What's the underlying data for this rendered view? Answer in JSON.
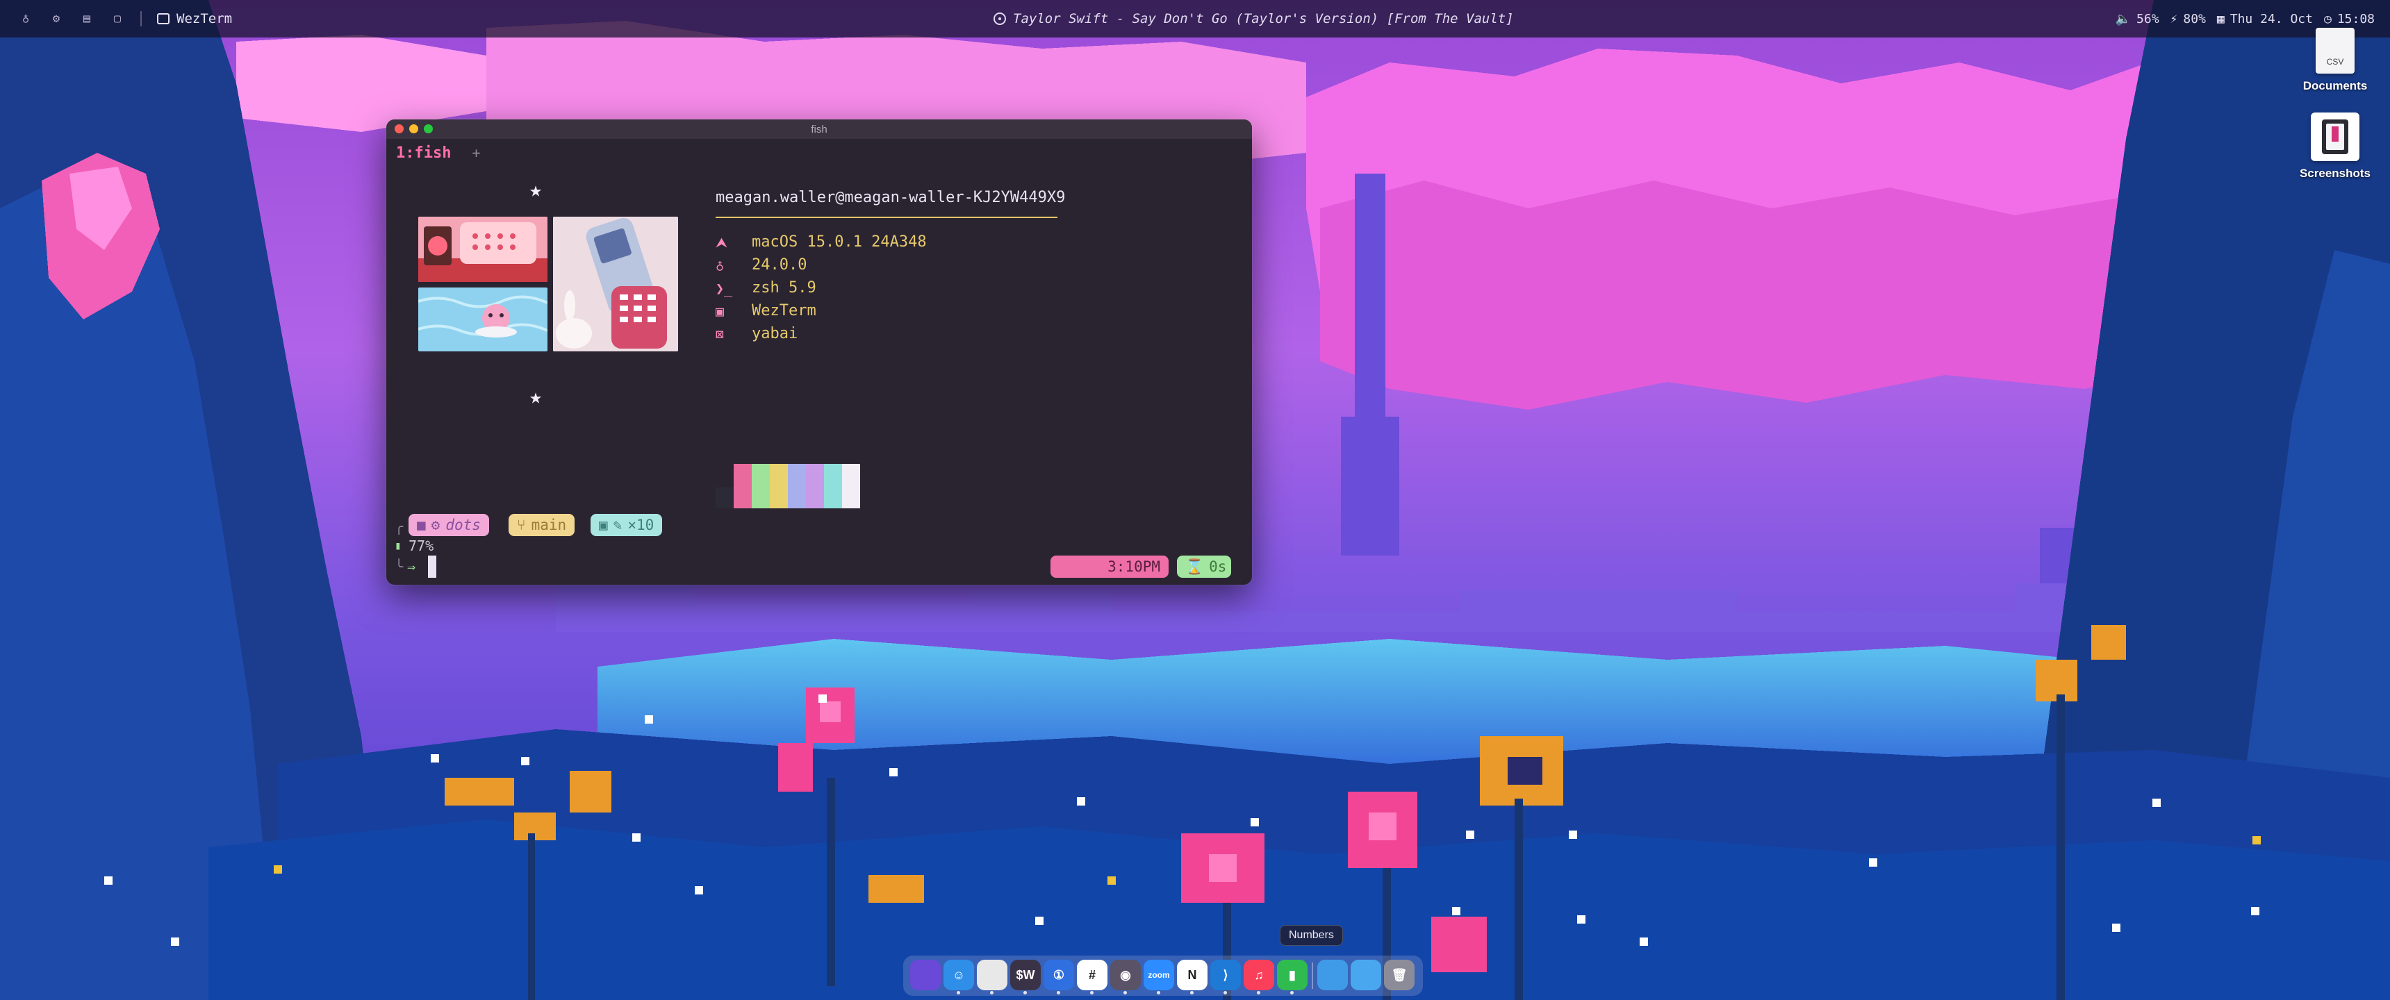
{
  "menubar": {
    "left_icons": [
      "cake-icon",
      "settings-icon",
      "stack-icon",
      "window-icon"
    ],
    "app_name": "WezTerm",
    "now_playing": "Taylor Swift - Say Don't Go (Taylor's Version) [From The Vault]",
    "volume": "56%",
    "battery": "80%",
    "date": "Thu 24. Oct",
    "time": "15:08"
  },
  "desktop": {
    "documents_label": "Documents",
    "documents_thumb_text": "CSV",
    "screenshots_label": "Screenshots"
  },
  "terminal": {
    "window_title": "fish",
    "tab_label": "1:fish",
    "tab_plus": "+",
    "fastfetch": {
      "user_host": "meagan.waller@meagan-waller-KJ2YW449X9",
      "rows": [
        {
          "icon": "⮝",
          "icon_name": "macos-icon",
          "value": "macOS 15.0.1 24A348"
        },
        {
          "icon": "♁",
          "icon_name": "kernel-icon",
          "value": "24.0.0"
        },
        {
          "icon": "❯_",
          "icon_name": "shell-icon",
          "value": "zsh 5.9"
        },
        {
          "icon": "▣",
          "icon_name": "terminal-icon",
          "value": "WezTerm"
        },
        {
          "icon": "⊠",
          "icon_name": "wm-icon",
          "value": "yabai"
        }
      ],
      "palette": [
        "#2c2a36",
        "#e96a9d",
        "#9fe39a",
        "#e8d36e",
        "#a7b0ec",
        "#c89ae8",
        "#8fe0dc",
        "#f2eef6"
      ]
    },
    "prompt": {
      "dir": "dots",
      "branch": "main",
      "pkg": "×10",
      "battery": "77%",
      "arrow": "⇒",
      "time": "3:10PM",
      "duration": "0s"
    }
  },
  "dock": {
    "tooltip": "Numbers",
    "apps": [
      {
        "name": "launcher",
        "glyph": "",
        "color": "#6a48d8"
      },
      {
        "name": "finder",
        "glyph": "☺",
        "color": "#2f8ee8"
      },
      {
        "name": "chrome",
        "glyph": "",
        "color": "#e8e8e8"
      },
      {
        "name": "sw-app",
        "glyph": "$W",
        "color": "#3a3348"
      },
      {
        "name": "1password",
        "glyph": "①",
        "color": "#2f6fe0"
      },
      {
        "name": "slack",
        "glyph": "#",
        "color": "#ffffff"
      },
      {
        "name": "github-desktop",
        "glyph": "◉",
        "color": "#5a5266"
      },
      {
        "name": "zoom",
        "glyph": "zoom",
        "color": "#2d8cff"
      },
      {
        "name": "notion",
        "glyph": "N",
        "color": "#ffffff"
      },
      {
        "name": "vscode",
        "glyph": "⟩",
        "color": "#1f7ad6"
      },
      {
        "name": "music",
        "glyph": "♫",
        "color": "#fa3f5b"
      },
      {
        "name": "numbers",
        "glyph": "▮",
        "color": "#2fbb4f"
      },
      {
        "name": "folder-apps",
        "glyph": "",
        "color": "#3f9be8"
      },
      {
        "name": "folder-downloads",
        "glyph": "",
        "color": "#49a7ef"
      },
      {
        "name": "trash",
        "glyph": "🗑",
        "color": "#8c8c98"
      }
    ]
  }
}
